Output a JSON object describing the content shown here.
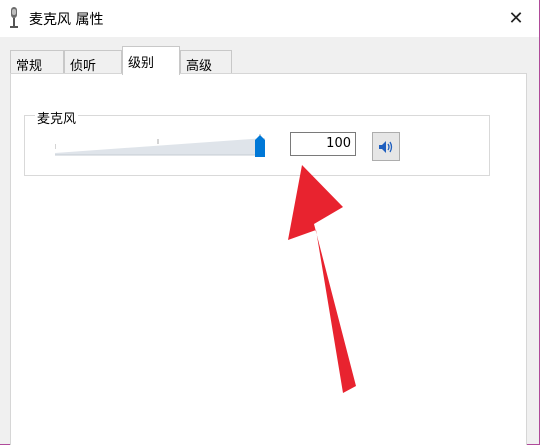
{
  "window": {
    "title": "麦克风 属性",
    "close_glyph": "✕"
  },
  "tabs": [
    {
      "label": "常规",
      "active": false
    },
    {
      "label": "侦听",
      "active": false
    },
    {
      "label": "级别",
      "active": true
    },
    {
      "label": "高级",
      "active": false
    }
  ],
  "levels": {
    "group_label": "麦克风",
    "microphone_level": "100",
    "slider_value_fraction": 1.0
  },
  "colors": {
    "accent": "#0078d7",
    "annotation_arrow": "#e8232f",
    "window_border": "#b04a9a"
  },
  "icons": {
    "title": "microphone-icon",
    "speaker": "speaker-icon"
  }
}
